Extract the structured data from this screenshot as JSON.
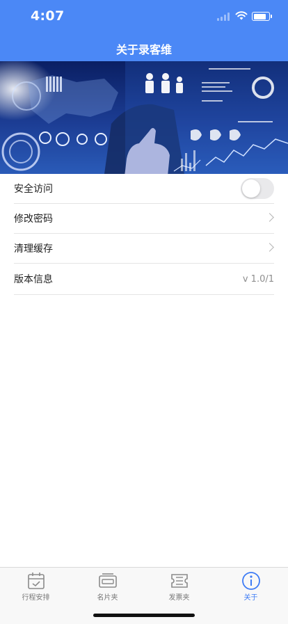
{
  "status": {
    "time": "4:07"
  },
  "header": {
    "title": "关于录客维"
  },
  "banner": {
    "image": "business-touch-screen-illustration"
  },
  "settings": {
    "secure_access": {
      "label": "安全访问",
      "toggle_on": false
    },
    "change_password": {
      "label": "修改密码"
    },
    "clear_cache": {
      "label": "清理缓存"
    },
    "version": {
      "label": "版本信息",
      "value": "v 1.0/1"
    }
  },
  "tabs": [
    {
      "label": "行程安排",
      "icon": "calendar-icon",
      "active": false
    },
    {
      "label": "名片夹",
      "icon": "card-holder-icon",
      "active": false
    },
    {
      "label": "发票夹",
      "icon": "ticket-icon",
      "active": false
    },
    {
      "label": "关于",
      "icon": "info-icon",
      "active": true
    }
  ],
  "colors": {
    "accent": "#4b88f6",
    "tab_active": "#3d7bf5",
    "tab_inactive": "#8a8a8a"
  }
}
